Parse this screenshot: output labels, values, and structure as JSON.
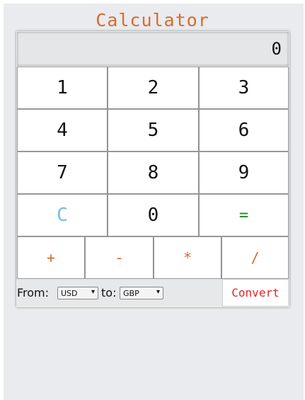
{
  "app": {
    "title": "Calculator"
  },
  "display": {
    "value": "0"
  },
  "keys": {
    "k1": "1",
    "k2": "2",
    "k3": "3",
    "k4": "4",
    "k5": "5",
    "k6": "6",
    "k7": "7",
    "k8": "8",
    "k9": "9",
    "clear": "C",
    "k0": "0",
    "equals": "=",
    "plus": "+",
    "minus": "-",
    "multiply": "*",
    "divide": "/"
  },
  "converter": {
    "from_label": "From:",
    "from_value": "USD",
    "to_label": "to:",
    "to_value": "GBP",
    "button_label": "Convert"
  },
  "colors": {
    "accent": "#d86b2b",
    "clear": "#7ab9ea",
    "equals": "#1f8a1f",
    "convert": "#e0262c"
  },
  "icons": {
    "select_arrow": "triangle-down-icon"
  }
}
